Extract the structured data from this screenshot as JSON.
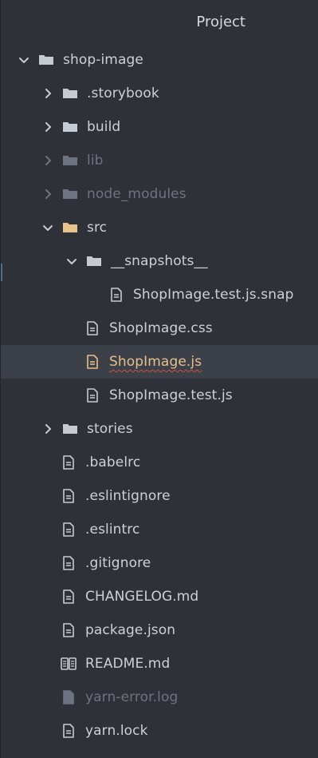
{
  "panel": {
    "title": "Project"
  },
  "tree": [
    {
      "label": "shop-image",
      "type": "folder",
      "expanded": true,
      "depth": 0,
      "muted": false,
      "selected": false,
      "icon": "folder-icon"
    },
    {
      "label": ".storybook",
      "type": "folder",
      "expanded": false,
      "depth": 1,
      "muted": false,
      "selected": false,
      "icon": "folder-icon"
    },
    {
      "label": "build",
      "type": "folder",
      "expanded": false,
      "depth": 1,
      "muted": false,
      "selected": false,
      "icon": "folder-icon"
    },
    {
      "label": "lib",
      "type": "folder",
      "expanded": false,
      "depth": 1,
      "muted": true,
      "selected": false,
      "icon": "folder-icon"
    },
    {
      "label": "node_modules",
      "type": "folder",
      "expanded": false,
      "depth": 1,
      "muted": true,
      "selected": false,
      "icon": "folder-icon"
    },
    {
      "label": "src",
      "type": "folder",
      "expanded": true,
      "depth": 1,
      "muted": false,
      "selected": false,
      "icon": "folder-open-icon",
      "accent": "#e8c48c"
    },
    {
      "label": "__snapshots__",
      "type": "folder",
      "expanded": true,
      "depth": 2,
      "muted": false,
      "selected": false,
      "icon": "folder-icon"
    },
    {
      "label": "ShopImage.test.js.snap",
      "type": "file",
      "depth": 3,
      "muted": false,
      "selected": false,
      "icon": "file-icon"
    },
    {
      "label": "ShopImage.css",
      "type": "file",
      "depth": 2,
      "muted": false,
      "selected": false,
      "icon": "file-icon"
    },
    {
      "label": "ShopImage.js",
      "type": "file",
      "depth": 2,
      "muted": false,
      "selected": true,
      "icon": "file-icon",
      "accent": "#e6c08a"
    },
    {
      "label": "ShopImage.test.js",
      "type": "file",
      "depth": 2,
      "muted": false,
      "selected": false,
      "icon": "file-icon"
    },
    {
      "label": "stories",
      "type": "folder",
      "expanded": false,
      "depth": 1,
      "muted": false,
      "selected": false,
      "icon": "folder-icon"
    },
    {
      "label": ".babelrc",
      "type": "file",
      "depth": 1,
      "muted": false,
      "selected": false,
      "icon": "file-icon"
    },
    {
      "label": ".eslintignore",
      "type": "file",
      "depth": 1,
      "muted": false,
      "selected": false,
      "icon": "file-icon"
    },
    {
      "label": ".eslintrc",
      "type": "file",
      "depth": 1,
      "muted": false,
      "selected": false,
      "icon": "file-icon"
    },
    {
      "label": ".gitignore",
      "type": "file",
      "depth": 1,
      "muted": false,
      "selected": false,
      "icon": "file-icon"
    },
    {
      "label": "CHANGELOG.md",
      "type": "file",
      "depth": 1,
      "muted": false,
      "selected": false,
      "icon": "file-icon"
    },
    {
      "label": "package.json",
      "type": "file",
      "depth": 1,
      "muted": false,
      "selected": false,
      "icon": "file-icon"
    },
    {
      "label": "README.md",
      "type": "file",
      "depth": 1,
      "muted": false,
      "selected": false,
      "icon": "book-icon"
    },
    {
      "label": "yarn-error.log",
      "type": "file",
      "depth": 1,
      "muted": true,
      "selected": false,
      "icon": "file-icon"
    },
    {
      "label": "yarn.lock",
      "type": "file",
      "depth": 1,
      "muted": false,
      "selected": false,
      "icon": "file-icon"
    }
  ],
  "colors": {
    "background": "#2e3138",
    "text": "#ccd1d9",
    "muted": "#6d7380",
    "selected_row": "#3c4049",
    "selected_text": "#e6c08a",
    "folder": "#c5cad3",
    "open_folder": "#e8c48c",
    "error_underline": "#c9553d"
  }
}
